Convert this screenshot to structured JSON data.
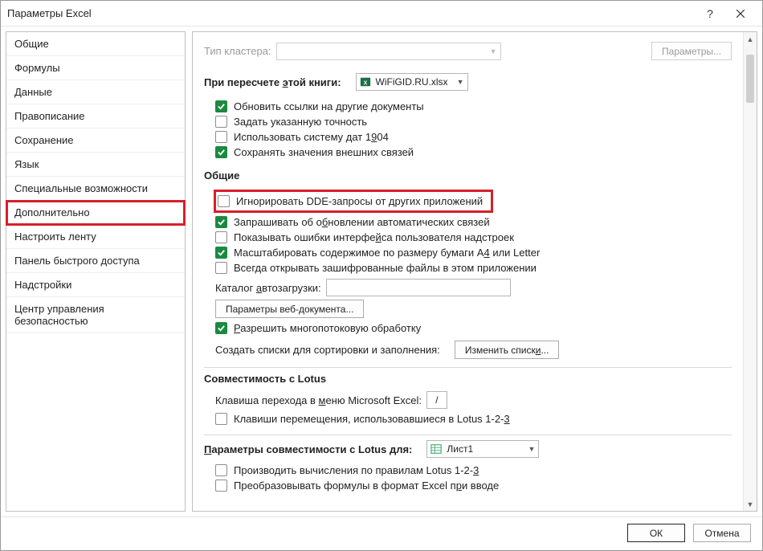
{
  "title": "Параметры Excel",
  "sidebar": {
    "items": [
      {
        "label": "Общие"
      },
      {
        "label": "Формулы"
      },
      {
        "label": "Данные"
      },
      {
        "label": "Правописание"
      },
      {
        "label": "Сохранение"
      },
      {
        "label": "Язык"
      },
      {
        "label": "Специальные возможности"
      },
      {
        "label": "Дополнительно"
      },
      {
        "label": "Настроить ленту"
      },
      {
        "label": "Панель быстрого доступа"
      },
      {
        "label": "Надстройки"
      },
      {
        "label": "Центр управления безопасностью"
      }
    ]
  },
  "content": {
    "cluster_type_label": "Тип кластера:",
    "cluster_params_btn": "Параметры...",
    "recalc_label_pre": "При пересчете ",
    "recalc_label_und": "э",
    "recalc_label_post": "той книги:",
    "workbook_selected": "WiFiGID.RU.xlsx",
    "chk_update_links": "Обновить ссылки на другие документы",
    "chk_set_precision": "Задать указанную точность",
    "chk_1904_pre": "Использовать систему дат 1",
    "chk_1904_und": "9",
    "chk_1904_post": "04",
    "chk_external": "Сохранять значения внешних связей",
    "section_general": "Общие",
    "chk_dde": "Игнорировать DDE-запросы от других приложений",
    "chk_auto_links_pre": "Запрашивать об о",
    "chk_auto_links_und": "б",
    "chk_auto_links_post": "новлении автоматических связей",
    "chk_ui_errors_pre": "Показывать ошибки интерфе",
    "chk_ui_errors_und": "й",
    "chk_ui_errors_post": "са пользователя надстроек",
    "chk_scale_pre": "Масштабировать содержимое по размеру бумаги A",
    "chk_scale_und": "4",
    "chk_scale_post": " или Letter",
    "chk_encrypted": "Всегда открывать зашифрованные файлы в этом приложении",
    "autoload_pre": "Каталог ",
    "autoload_und": "а",
    "autoload_post": "втозагрузки:",
    "web_params_btn": "Параметры веб-документа...",
    "chk_multithread_pre": "Р",
    "chk_multithread_post": "азрешить многопотоковую обработку",
    "sort_lists_label": "Создать списки для сортировки и заполнения:",
    "sort_lists_btn_pre": "Изменить списк",
    "sort_lists_btn_und": "и",
    "sort_lists_btn_post": "...",
    "section_lotus": "Совместимость с Lotus",
    "lotus_key_label_pre": "Клавиша перехода в ",
    "lotus_key_label_und": "м",
    "lotus_key_label_post": "еню Microsoft Excel:",
    "lotus_key_value": "/",
    "chk_lotus_nav_pre": "Клавиши перемещения, использовавшиеся в Lotus 1-2-",
    "chk_lotus_nav_und": "3",
    "lotus_params_label_pre": "П",
    "lotus_params_label_post": "араметры совместимости с Lotus для:",
    "sheet_selected": "Лист1",
    "chk_lotus_calc_pre": "Производить вычисления по правилам Lotus 1-2-",
    "chk_lotus_calc_und": "3",
    "chk_lotus_convert_pre": "Преобразовывать формулы в формат Excel п",
    "chk_lotus_convert_und": "р",
    "chk_lotus_convert_post": "и вводе"
  },
  "footer": {
    "ok": "ОК",
    "cancel": "Отмена"
  }
}
